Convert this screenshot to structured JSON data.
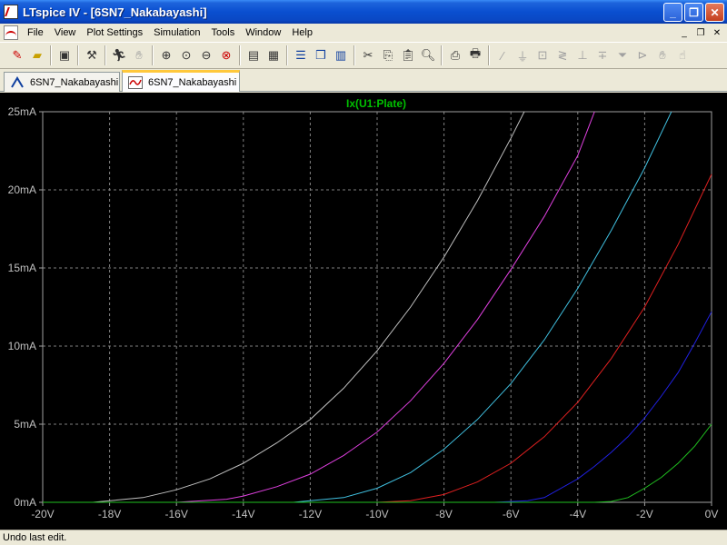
{
  "window": {
    "title": "LTspice IV - [6SN7_Nakabayashi]",
    "minimize": "_",
    "maximize": "❐",
    "close": "✕"
  },
  "menu": {
    "items": [
      "File",
      "View",
      "Plot Settings",
      "Simulation",
      "Tools",
      "Window",
      "Help"
    ],
    "mdi_minimize": "_",
    "mdi_restore": "❐",
    "mdi_close": "✕"
  },
  "toolbar": {
    "icons": [
      "zoom-in",
      "zoom-out"
    ]
  },
  "tabs": [
    {
      "label": "6SN7_Nakabayashi",
      "kind": "schematic"
    },
    {
      "label": "6SN7_Nakabayashi",
      "kind": "waveform",
      "active": true
    }
  ],
  "status": {
    "text": "Undo last edit."
  },
  "chart_data": {
    "type": "line",
    "title": "Ix(U1:Plate)",
    "x_ticks": [
      "-20V",
      "-18V",
      "-16V",
      "-14V",
      "-12V",
      "-10V",
      "-8V",
      "-6V",
      "-4V",
      "-2V",
      "0V"
    ],
    "y_ticks": [
      "0mA",
      "5mA",
      "10mA",
      "15mA",
      "20mA",
      "25mA"
    ],
    "xlim": [
      -20,
      0
    ],
    "ylim": [
      0,
      25
    ],
    "grid": true,
    "colors": {
      "background": "#000000",
      "grid": "#808080",
      "title": "#00C000",
      "axis_text": "#C0C0C0",
      "plot_border": "#A0A0A0"
    },
    "series": [
      {
        "color": "#C0C0C0",
        "x": [
          -18.5,
          -17,
          -16,
          -15,
          -14,
          -13,
          -12,
          -11,
          -10,
          -9,
          -8,
          -7,
          -6,
          -5.6
        ],
        "y": [
          0,
          0.3,
          0.8,
          1.5,
          2.5,
          3.8,
          5.3,
          7.3,
          9.7,
          12.5,
          15.7,
          19.3,
          23.3,
          25
        ]
      },
      {
        "color": "#E040E0",
        "x": [
          -16,
          -14.5,
          -14,
          -13,
          -12,
          -11,
          -10,
          -9,
          -8,
          -7,
          -6,
          -5,
          -4,
          -3.5
        ],
        "y": [
          0,
          0.2,
          0.4,
          1.0,
          1.8,
          3.0,
          4.5,
          6.5,
          8.9,
          11.7,
          14.9,
          18.3,
          22.2,
          25
        ]
      },
      {
        "color": "#40C0E0",
        "x": [
          -12.5,
          -11,
          -10,
          -9,
          -8,
          -7,
          -6,
          -5,
          -4,
          -3,
          -2,
          -1.2
        ],
        "y": [
          0,
          0.3,
          0.9,
          1.9,
          3.4,
          5.3,
          7.6,
          10.4,
          13.7,
          17.4,
          21.4,
          25
        ]
      },
      {
        "color": "#E02020",
        "x": [
          -10,
          -9,
          -8,
          -7,
          -6,
          -5,
          -4,
          -3,
          -2,
          -1,
          0
        ],
        "y": [
          0,
          0.1,
          0.5,
          1.3,
          2.5,
          4.2,
          6.4,
          9.2,
          12.5,
          16.5,
          21
        ]
      },
      {
        "color": "#2020E0",
        "x": [
          -6.5,
          -5.5,
          -5,
          -4,
          -3.5,
          -3,
          -2.5,
          -2,
          -1.5,
          -1,
          -0.5,
          0
        ],
        "y": [
          0,
          0.1,
          0.3,
          1.5,
          2.3,
          3.2,
          4.2,
          5.4,
          6.8,
          8.3,
          10.2,
          12.2
        ]
      },
      {
        "color": "#20C020",
        "x": [
          -3.5,
          -3,
          -2.5,
          -2,
          -1.5,
          -1,
          -0.5,
          0
        ],
        "y": [
          0,
          0.05,
          0.3,
          0.9,
          1.6,
          2.5,
          3.6,
          5.0
        ]
      }
    ]
  }
}
